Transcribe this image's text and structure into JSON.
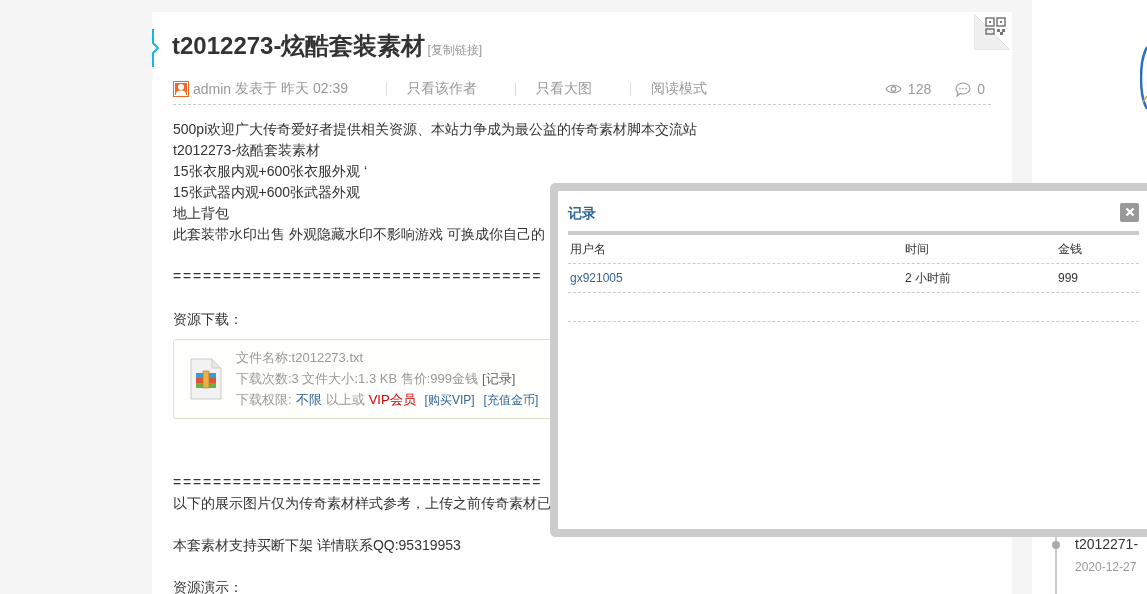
{
  "post": {
    "title": "t2012273-炫酷套装素材",
    "copy_link": "[复制链接]",
    "author": "admin",
    "posted": "发表于 昨天 02:39",
    "actions": [
      "只看该作者",
      "只看大图",
      "阅读模式"
    ],
    "views": "128",
    "replies": "0"
  },
  "intro_lines": [
    "500pi欢迎广大传奇爱好者提供相关资源、本站力争成为最公益的传奇素材脚本交流站",
    "t2012273-炫酷套装素材",
    "15张衣服内观+600张衣服外观 ‘",
    "15张武器内观+600张武器外观",
    "地上背包",
    "此套装带水印出售 外观隐藏水印不影响游戏 可换成你自己的"
  ],
  "rule_1": "=====================================",
  "download_heading": "资源下载：",
  "attachment": {
    "file_name": "文件名称:t2012273.txt",
    "stats": "下载次数:3  文件大小:1.3 KB  售价:999金钱",
    "records_link": "[记录]",
    "permission_label": "下载权限:",
    "permission_level": "不限",
    "permission_or": "以上或",
    "vip": "VIP会员",
    "buy_vip": "[购买VIP]",
    "recharge": "[充值金币]"
  },
  "rule_2": "=====================================",
  "notice": "以下的展示图片仅为传奇素材样式参考，上传之前传奇素材已",
  "contact": "本套素材支持买断下架 详情联系QQ:95319953",
  "demo_heading": "资源演示：",
  "sidebar": {
    "recent": [
      {
        "title": "t2012271-",
        "date": "2020-12-27"
      }
    ]
  },
  "dialog": {
    "title": "记录",
    "columns": [
      "用户名",
      "时间",
      "金钱"
    ],
    "rows": [
      {
        "user": "gx921005",
        "time": "2 小时前",
        "money": "999"
      }
    ]
  }
}
